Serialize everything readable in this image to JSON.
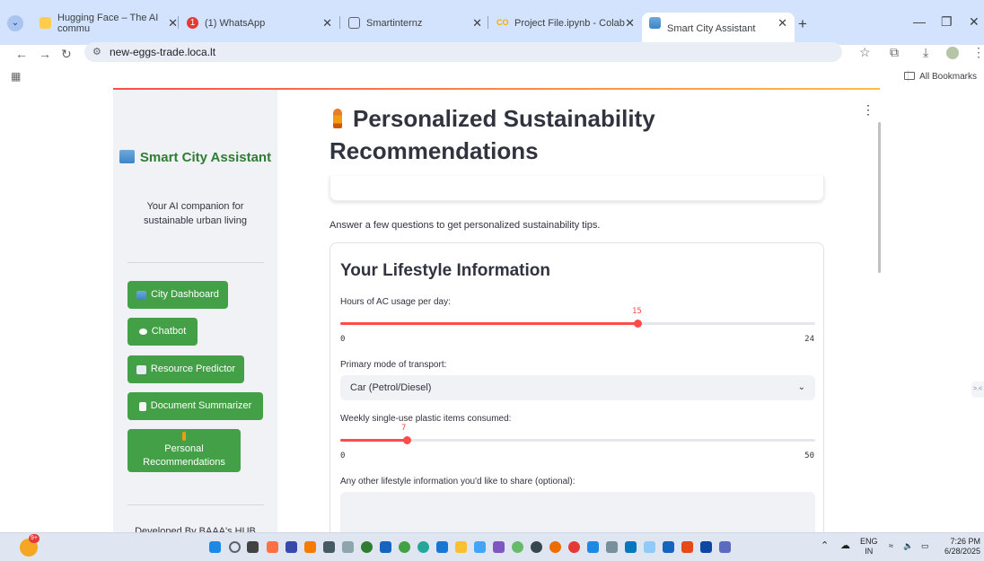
{
  "browser": {
    "tabs": [
      {
        "title": "Hugging Face – The AI commu",
        "icon": "hugging-face-icon"
      },
      {
        "title": "(1) WhatsApp",
        "icon": "whatsapp-icon"
      },
      {
        "title": "Smartinternz",
        "icon": "smartinternz-icon"
      },
      {
        "title": "Project File.ipynb - Colab",
        "icon": "colab-icon"
      },
      {
        "title": "Smart City Assistant",
        "icon": "app-icon",
        "active": true
      }
    ],
    "url": "new-eggs-trade.loca.lt",
    "bookmarks_label": "All Bookmarks"
  },
  "sidebar": {
    "title": "Smart City Assistant",
    "subtitle": "Your AI companion for sustainable urban living",
    "nav": [
      {
        "label": "City Dashboard",
        "icon": "city-icon"
      },
      {
        "label": "Chatbot",
        "icon": "speech-bubble-icon"
      },
      {
        "label": "Resource Predictor",
        "icon": "chart-icon"
      },
      {
        "label": "Document Summarizer",
        "icon": "document-icon"
      },
      {
        "label": "Personal Recommendations",
        "icon": "person-icon"
      }
    ],
    "footer": "Developed By BAAA's HUB"
  },
  "main": {
    "title": "Personalized Sustainability Recommendations",
    "intro": "Answer a few questions to get personalized sustainability tips.",
    "form": {
      "title": "Your Lifestyle Information",
      "ac_label": "Hours of AC usage per day:",
      "ac_value": 15,
      "ac_min": 0,
      "ac_max": 24,
      "transport_label": "Primary mode of transport:",
      "transport_value": "Car (Petrol/Diesel)",
      "plastic_label": "Weekly single-use plastic items consumed:",
      "plastic_value": 7,
      "plastic_min": 0,
      "plastic_max": 50,
      "other_label": "Any other lifestyle information you'd like to share (optional):"
    }
  },
  "taskbar": {
    "lang_top": "ENG",
    "lang_bottom": "IN",
    "time": "7:26 PM",
    "date": "6/28/2025",
    "notification_count": "9+"
  },
  "colors": {
    "accent": "#ff4b4b",
    "sidebar_button": "#43a047",
    "sidebar_title": "#2e7d32"
  }
}
